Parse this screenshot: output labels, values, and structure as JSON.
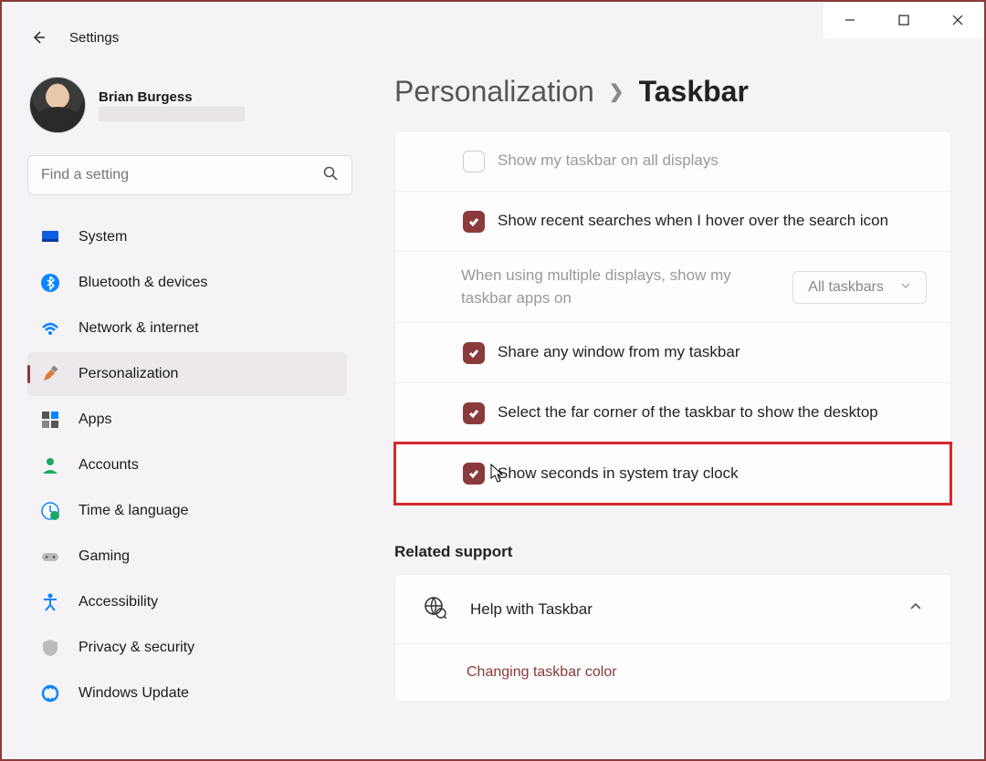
{
  "window": {
    "app_title": "Settings",
    "minimize": "Minimize",
    "maximize": "Maximize",
    "close": "Close"
  },
  "profile": {
    "name": "Brian Burgess"
  },
  "search": {
    "placeholder": "Find a setting"
  },
  "nav": [
    {
      "id": "system",
      "label": "System"
    },
    {
      "id": "bluetooth",
      "label": "Bluetooth & devices"
    },
    {
      "id": "network",
      "label": "Network & internet"
    },
    {
      "id": "personalization",
      "label": "Personalization"
    },
    {
      "id": "apps",
      "label": "Apps"
    },
    {
      "id": "accounts",
      "label": "Accounts"
    },
    {
      "id": "time",
      "label": "Time & language"
    },
    {
      "id": "gaming",
      "label": "Gaming"
    },
    {
      "id": "accessibility",
      "label": "Accessibility"
    },
    {
      "id": "privacy",
      "label": "Privacy & security"
    },
    {
      "id": "update",
      "label": "Windows Update"
    }
  ],
  "breadcrumb": {
    "parent": "Personalization",
    "current": "Taskbar"
  },
  "settings": [
    {
      "id": "all-displays",
      "label": "Show my taskbar on all displays",
      "checked": false,
      "disabled": true
    },
    {
      "id": "recent-search",
      "label": "Show recent searches when I hover over the search icon",
      "checked": true
    },
    {
      "id": "multi-display",
      "label": "When using multiple displays, show my taskbar apps on",
      "dropdown": "All taskbars",
      "disabled": true
    },
    {
      "id": "share-window",
      "label": "Share any window from my taskbar",
      "checked": true
    },
    {
      "id": "far-corner",
      "label": "Select the far corner of the taskbar to show the desktop",
      "checked": true
    },
    {
      "id": "seconds",
      "label": "Show seconds in system tray clock",
      "checked": true,
      "highlighted": true
    }
  ],
  "related": {
    "heading": "Related support",
    "help_title": "Help with Taskbar",
    "link1": "Changing taskbar color"
  },
  "colors": {
    "accent": "#8a3a3a",
    "highlight": "#d42a2a"
  }
}
